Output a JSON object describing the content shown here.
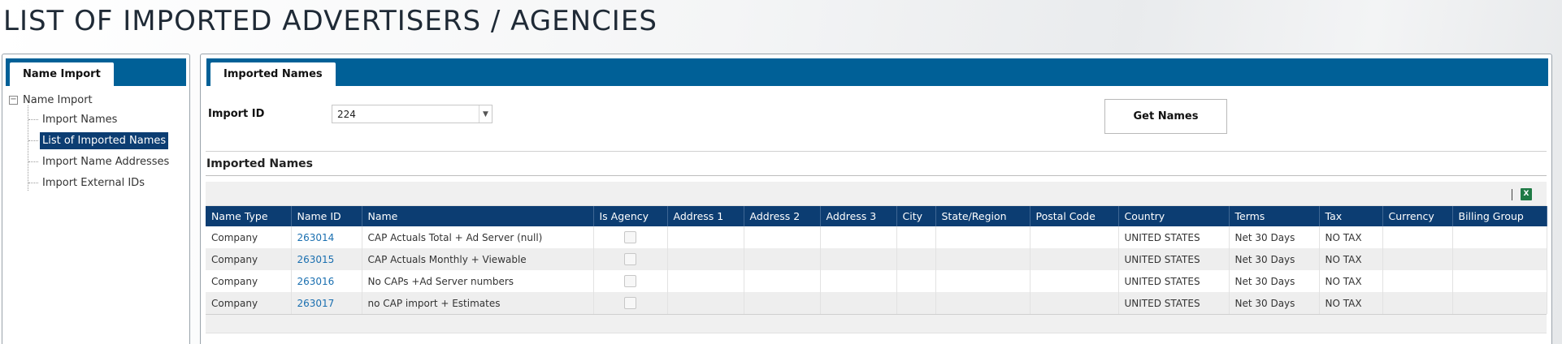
{
  "page": {
    "title": "LIST OF IMPORTED ADVERTISERS / AGENCIES"
  },
  "left_panel": {
    "tab_label": "Name Import",
    "tree": {
      "root_label": "Name Import",
      "items": [
        {
          "label": "Import Names",
          "selected": false
        },
        {
          "label": "List of Imported Names",
          "selected": true
        },
        {
          "label": "Import Name Addresses",
          "selected": false
        },
        {
          "label": "Import External IDs",
          "selected": false
        }
      ]
    }
  },
  "main_panel": {
    "tab_label": "Imported Names",
    "import_id": {
      "label": "Import ID",
      "value": "224"
    },
    "get_names_label": "Get Names",
    "section_title": "Imported Names",
    "grid": {
      "columns": [
        "Name Type",
        "Name ID",
        "Name",
        "Is Agency",
        "Address 1",
        "Address 2",
        "Address 3",
        "City",
        "State/Region",
        "Postal Code",
        "Country",
        "Terms",
        "Tax",
        "Currency",
        "Billing Group"
      ],
      "rows": [
        {
          "name_type": "Company",
          "name_id": "263014",
          "name": "CAP Actuals Total + Ad Server (null)",
          "is_agency": false,
          "address1": "",
          "address2": "",
          "address3": "",
          "city": "",
          "state": "",
          "postal": "",
          "country": "UNITED STATES",
          "terms": "Net 30 Days",
          "tax": "NO TAX",
          "currency": "",
          "billing_group": ""
        },
        {
          "name_type": "Company",
          "name_id": "263015",
          "name": "CAP Actuals Monthly + Viewable",
          "is_agency": false,
          "address1": "",
          "address2": "",
          "address3": "",
          "city": "",
          "state": "",
          "postal": "",
          "country": "UNITED STATES",
          "terms": "Net 30 Days",
          "tax": "NO TAX",
          "currency": "",
          "billing_group": ""
        },
        {
          "name_type": "Company",
          "name_id": "263016",
          "name": "No CAPs +Ad Server numbers",
          "is_agency": false,
          "address1": "",
          "address2": "",
          "address3": "",
          "city": "",
          "state": "",
          "postal": "",
          "country": "UNITED STATES",
          "terms": "Net 30 Days",
          "tax": "NO TAX",
          "currency": "",
          "billing_group": ""
        },
        {
          "name_type": "Company",
          "name_id": "263017",
          "name": "no CAP import + Estimates",
          "is_agency": false,
          "address1": "",
          "address2": "",
          "address3": "",
          "city": "",
          "state": "",
          "postal": "",
          "country": "UNITED STATES",
          "terms": "Net 30 Days",
          "tax": "NO TAX",
          "currency": "",
          "billing_group": ""
        }
      ]
    }
  },
  "icons": {
    "export": "excel-export-icon",
    "tree_expander": "tree-collapse-icon",
    "dropdown": "chevron-down-icon"
  },
  "colors": {
    "tab_bar": "#006097",
    "header_bg": "#0c3d72",
    "link": "#1a6fb0",
    "excel": "#1f7a45"
  }
}
